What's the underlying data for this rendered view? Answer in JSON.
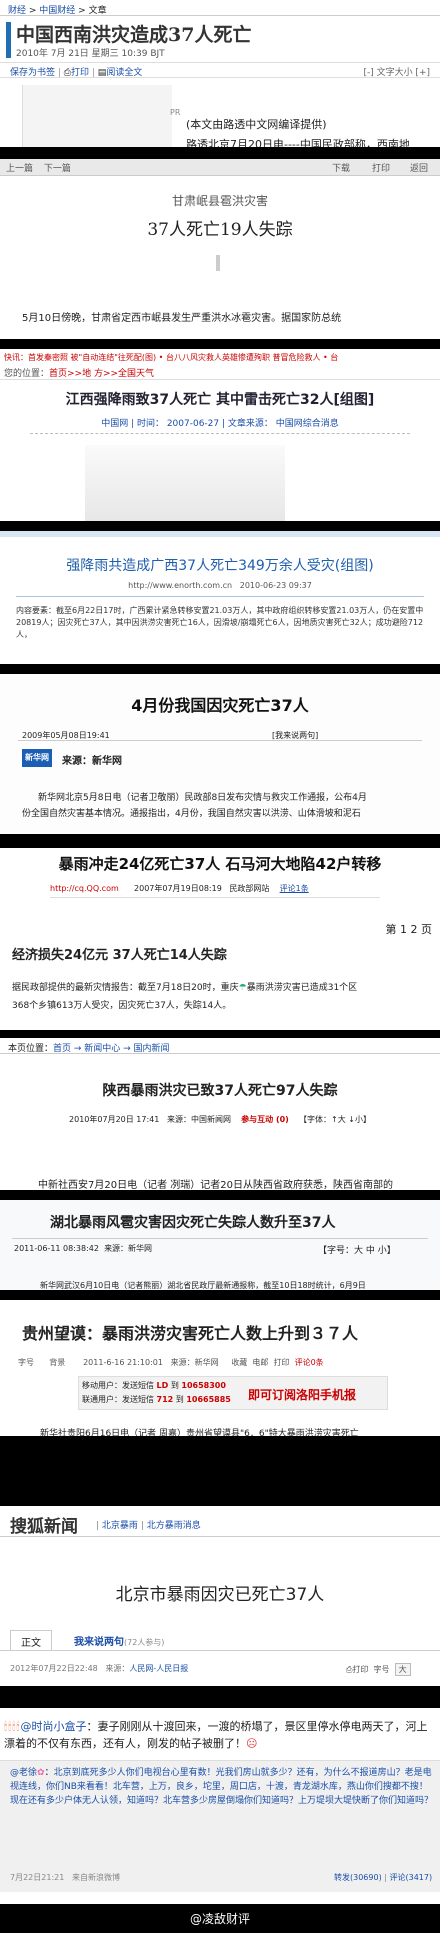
{
  "p1": {
    "crumbs": [
      "财经",
      "中国财经",
      "文章"
    ],
    "title": "中国西南洪灾造成37人死亡",
    "date": "2010年 7月 21日 星期三 10:39 BJT",
    "tools": [
      "保存为书签",
      "打印",
      "阅读全文"
    ],
    "fontsize": "[-] 文字大小 [+]",
    "pr": "PR",
    "source": "(本文由路透中文网编译提供)",
    "body": "路透北京7月20日电----中国民政部称，西南地"
  },
  "p2": {
    "strip": [
      "上一篇",
      "下一篇",
      "下载",
      "打印",
      "返回"
    ],
    "title1": "甘肃岷县雹洪灾害",
    "title2": "37人死亡19人失踪",
    "body": "5月10日傍晚，甘肃省定西市岷县发生严重洪水冰雹灾害。据国家防总统"
  },
  "p3": {
    "quick_label": "快讯：",
    "quick": "首发秦密照 被\"自动连结\"往死配(图)  • 台八八风灾救人英雄惨遭殉职  普冒危险救人 • 台",
    "loc_label": "您的位置：",
    "loc": "首页>>地 方>>全国天气",
    "title": "江西强降雨致37人死亡 其中雷击死亡32人[组图]",
    "meta_src": "中国网",
    "meta_date": "时间： 2007-06-27",
    "meta_from": "文章来源：",
    "meta_from_val": "中国网综合消息"
  },
  "p4": {
    "title": "强降雨共造成广西37人死亡349万余人受灾(组图)",
    "url": "http://www.enorth.com.cn",
    "date": "2010-06-23 09:37",
    "summary": "内容要素：截至6月22日17时，广西累计紧急转移安置21.03万人，其中政府组织转移安置21.03万人，仍在安置中20819人；因灾死亡37人，其中因洪涝灾害死亡16人，因滑坡/崩塌死亡6人，因地质灾害死亡32人；成功避险712人，"
  },
  "p5": {
    "title": "4月份我国因灾死亡37人",
    "date": "2009年05月08日19:41",
    "links": "[我来说两句]",
    "fontlabel": "[字号：大 中 小]",
    "logo": "新华网",
    "source_label": "来源：",
    "source": "新华网",
    "body1": "新华网北京5月8日电（记者卫敬丽）民政部8日发布灾情与救灾工作通报，公布4月",
    "body2": "份全国自然灾害基本情况。通报指出，4月份，我国自然灾害以洪涝、山体滑坡和泥石"
  },
  "p6": {
    "title": "暴雨冲走24亿死亡37人 石马河大地陷42户转移",
    "url": "http://cq.QQ.com",
    "date": "2007年07月19日08:19",
    "src": "民政部网站",
    "comment": "评论1条",
    "pager": "第 1 2 页",
    "subtitle": "经济损失24亿元 37人死亡14人失踪",
    "body1": "据民政部提供的最新灾情报告：截至7月18日20时，重庆",
    "body1b": "暴雨洪涝灾害已造成31个区",
    "body2": "368个乡镇613万人受灾，因灾死亡37人，失踪14人。"
  },
  "p7": {
    "loc_label": "本页位置：",
    "loc": "首页 → 新闻中心 → 国内新闻",
    "title": "陕西暴雨洪灾已致37人死亡97人失踪",
    "date": "2010年07月20日 17:41",
    "src": "来源：中国新闻网",
    "interact": "参与互动 (0)",
    "fontsize": "【字体：↑大 ↓小】",
    "body": "中新社西安7月20日电（记者 冽瑞）记者20日从陕西省政府获悉，陕西省南部的"
  },
  "p8": {
    "title": "湖北暴雨风雹灾害因灾死亡失踪人数升至37人",
    "date": "2011-06-11 08:38:42",
    "src": "来源：新华网",
    "fontsize": "【字号：大 中 小】",
    "body": "新华网武汉6月10日电（记者熊丽）湖北省民政厅最新通报称，截至10日18时统计，6月9日"
  },
  "p9": {
    "title": "贵州望谟：暴雨洪涝灾害死亡人数上升到３７人",
    "bar": [
      "字号",
      "背景",
      "2011-6-16 21:10:01",
      "来源：新华网",
      "收藏",
      "电邮",
      "打印",
      "评论0条"
    ],
    "sms1_label": "移动用户：发送短信",
    "sms1_code": "LD",
    "sms1_to": "到",
    "sms1_num": "10658300",
    "sms2_label": "联通用户：发送短信",
    "sms2_code": "712",
    "sms2_to": "到",
    "sms2_num": "10665885",
    "promo": "即可订阅洛阳手机报",
    "body": "新华社贵阳6月16日电（记者 周嘉）贵州省望谟县\"6．6\"特大暴雨洪涝灾害死亡"
  },
  "p10": {
    "logo": "搜狐新闻",
    "crumbs": [
      "北京暴雨",
      "北方暴雨消息"
    ],
    "title": "北京市暴雨因灾已死亡37人",
    "tab1": "正文",
    "tab2": "我来说两句",
    "tab2_count": "(72人参与)",
    "date": "2012年07月22日22:48",
    "src": "来源：",
    "src_val": "人民网-人民日报",
    "tools": [
      "打印",
      "字号",
      "大"
    ]
  },
  "p11": {
    "user1": "@时尚小盒子",
    "text1": "妻子刚刚从十渡回来，一渡的桥塌了，景区里停水停电两天了，河上漂着的不仅有东西，还有人，刚发的帖子被删了！",
    "user2": "@老徐",
    "text2": "北京到底死多少人你们电视台心里有数！光我们房山就多少？还有，为什么不报道房山？老是电视连线，你们NB来看看！北车营，上万，良乡，坨里，周口店，十渡，青龙湖水库，燕山你们搜都不搜！现在还有多少户体无人认领，知道吗？北车营多少房屋倒塌你们知道吗？上万堤坝大堤快断了你们知道吗？",
    "time": "7月22日21:21",
    "from": "来自新浪微博",
    "repost": "转发(30690)",
    "comments": "评论(3417)",
    "sig": "@凌敌财评"
  }
}
